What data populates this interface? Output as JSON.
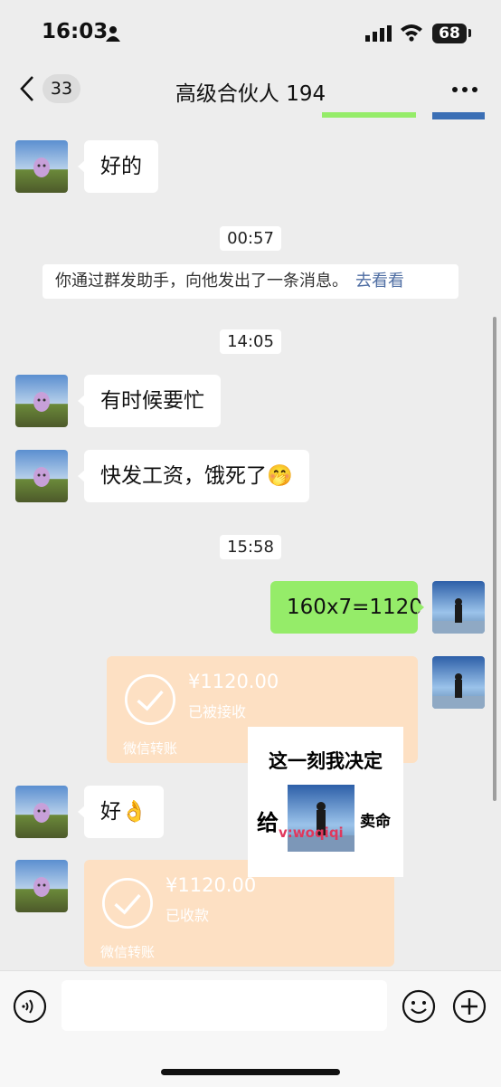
{
  "status_bar": {
    "time": "16:03",
    "battery": "68"
  },
  "header": {
    "unread_count": "33",
    "title": "高级合伙人 194"
  },
  "messages": {
    "m1": "好的",
    "t1": "00:57",
    "system_text": "你通过群发助手，向他发出了一条消息。",
    "system_link": "去看看",
    "t2": "14:05",
    "m2": "有时候要忙",
    "m3": "快发工资，饿死了🤭",
    "t3": "15:58",
    "m4": "160x7=1120",
    "transfer1": {
      "amount": "¥1120.00",
      "status": "已被接收",
      "footer": "微信转账"
    },
    "m5": "好👌",
    "transfer2": {
      "amount": "¥1120.00",
      "status": "已收款",
      "footer": "微信转账"
    }
  },
  "sticker": {
    "top": "这一刻我决定",
    "left": "给",
    "right": "卖命",
    "watermark": "v:woqiqi"
  },
  "colors": {
    "bg": "#ededed",
    "green_bubble": "#95ec69",
    "transfer": "#fde0c3",
    "link": "#4f6ea3"
  },
  "icons": [
    "person-icon",
    "signal-icon",
    "wifi-icon",
    "back-chevron-icon",
    "more-icon",
    "check-icon",
    "voice-icon",
    "emoji-icon",
    "plus-icon"
  ]
}
